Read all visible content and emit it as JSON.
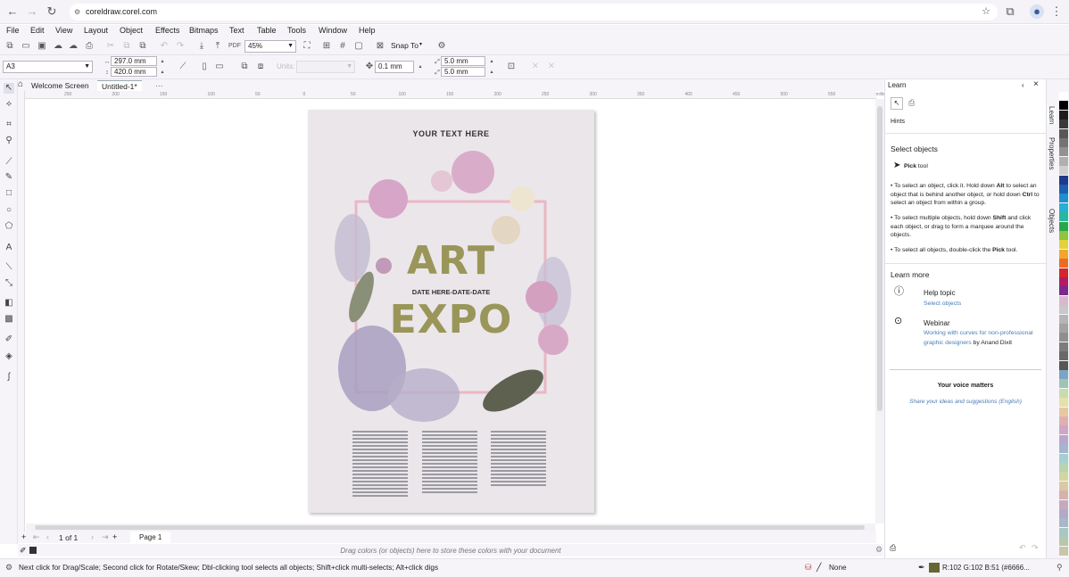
{
  "browser": {
    "url": "coreldraw.corel.com"
  },
  "menu": [
    "File",
    "Edit",
    "View",
    "Layout",
    "Object",
    "Effects",
    "Bitmaps",
    "Text",
    "Table",
    "Tools",
    "Window",
    "Help"
  ],
  "toolbar": {
    "zoom": "45%",
    "snap_label": "Snap To"
  },
  "propbar": {
    "page_size": "A3",
    "width": "297.0 mm",
    "height": "420.0 mm",
    "units_label": "Units:",
    "nudge": "0.1 mm",
    "dup_x": "5.0 mm",
    "dup_y": "5.0 mm"
  },
  "tabs": {
    "welcome": "Welcome Screen",
    "doc": "Untitled-1*"
  },
  "ruler_labels": [
    "250",
    "200",
    "150",
    "100",
    "50",
    "0",
    "50",
    "100",
    "150",
    "200",
    "250",
    "300",
    "350",
    "400",
    "450",
    "500",
    "550",
    "millimeters"
  ],
  "poster": {
    "top_text": "YOUR TEXT HERE",
    "word1": "ART",
    "date_line": "DATE HERE-DATE-DATE",
    "word2": "EXPO"
  },
  "pagebar": {
    "count": "1 of 1",
    "page_tab": "Page 1"
  },
  "color_hint": "Drag colors (or objects) here to store these colors with your document",
  "status": {
    "hint": "Next click for Drag/Scale; Second click for Rotate/Skew; Dbl-clicking tool selects all objects; Shift+click multi-selects; Alt+click digs",
    "fill": "None",
    "color_readout": "R:102 G:102 B:51 (#6666..."
  },
  "learn": {
    "title": "Learn",
    "hints": "Hints",
    "heading": "Select objects",
    "tool": "Pick",
    "tool_suffix": " tool",
    "b1a": "To select an object, click it. Hold down ",
    "b1b": "Alt",
    "b1c": " to select an object that is behind another object, or hold down ",
    "b1d": "Ctrl",
    "b1e": " to select an object from within a group.",
    "b2a": "To select multiple objects, hold down ",
    "b2b": "Shift",
    "b2c": " and click each object, or drag to form a marquee around the objects.",
    "b3a": "To select all objects, double-click the ",
    "b3b": "Pick",
    "b3c": " tool.",
    "learn_more": "Learn more",
    "help_topic": "Help topic",
    "help_link": "Select objects",
    "webinar": "Webinar",
    "webinar_link": "Working with curves for non-professional graphic designers",
    "webinar_by": " by Anand Dixit",
    "voice": "Your voice matters",
    "voice_link": "Share your ideas and suggestions (English)"
  },
  "side_tabs": [
    "Learn",
    "Properties",
    "Objects"
  ],
  "palette": [
    "#ffffff",
    "#000000",
    "#1d1d1d",
    "#3a3a3a",
    "#575757",
    "#747474",
    "#929292",
    "#b0b0b0",
    "#cfcfcf",
    "#1f3a8c",
    "#1e5fb0",
    "#1e8fcf",
    "#23b0d4",
    "#25b89c",
    "#2aa64a",
    "#8fc43e",
    "#e2d33b",
    "#f4a62a",
    "#ec6a25",
    "#d6262b",
    "#b31c63",
    "#7a2a8c",
    "#d9b7cf",
    "#c8c8c8",
    "#b5b5b5",
    "#a2a2a2",
    "#8f8f8f",
    "#7c7c7c",
    "#696969",
    "#565656",
    "#7aa5c6",
    "#9ec5b3",
    "#c9dcae",
    "#e6e0a9",
    "#e8c8a0",
    "#e0b0b0",
    "#cfa6c6",
    "#b9a6cf",
    "#a6b5cf",
    "#a6cfcf",
    "#b7d4b0",
    "#d1d6a3",
    "#dcc8a3",
    "#d4b3a9",
    "#c7a9bf",
    "#b2a9c8",
    "#a9b8c8",
    "#a9c8c4",
    "#b6c8a9",
    "#c8c6a9"
  ]
}
